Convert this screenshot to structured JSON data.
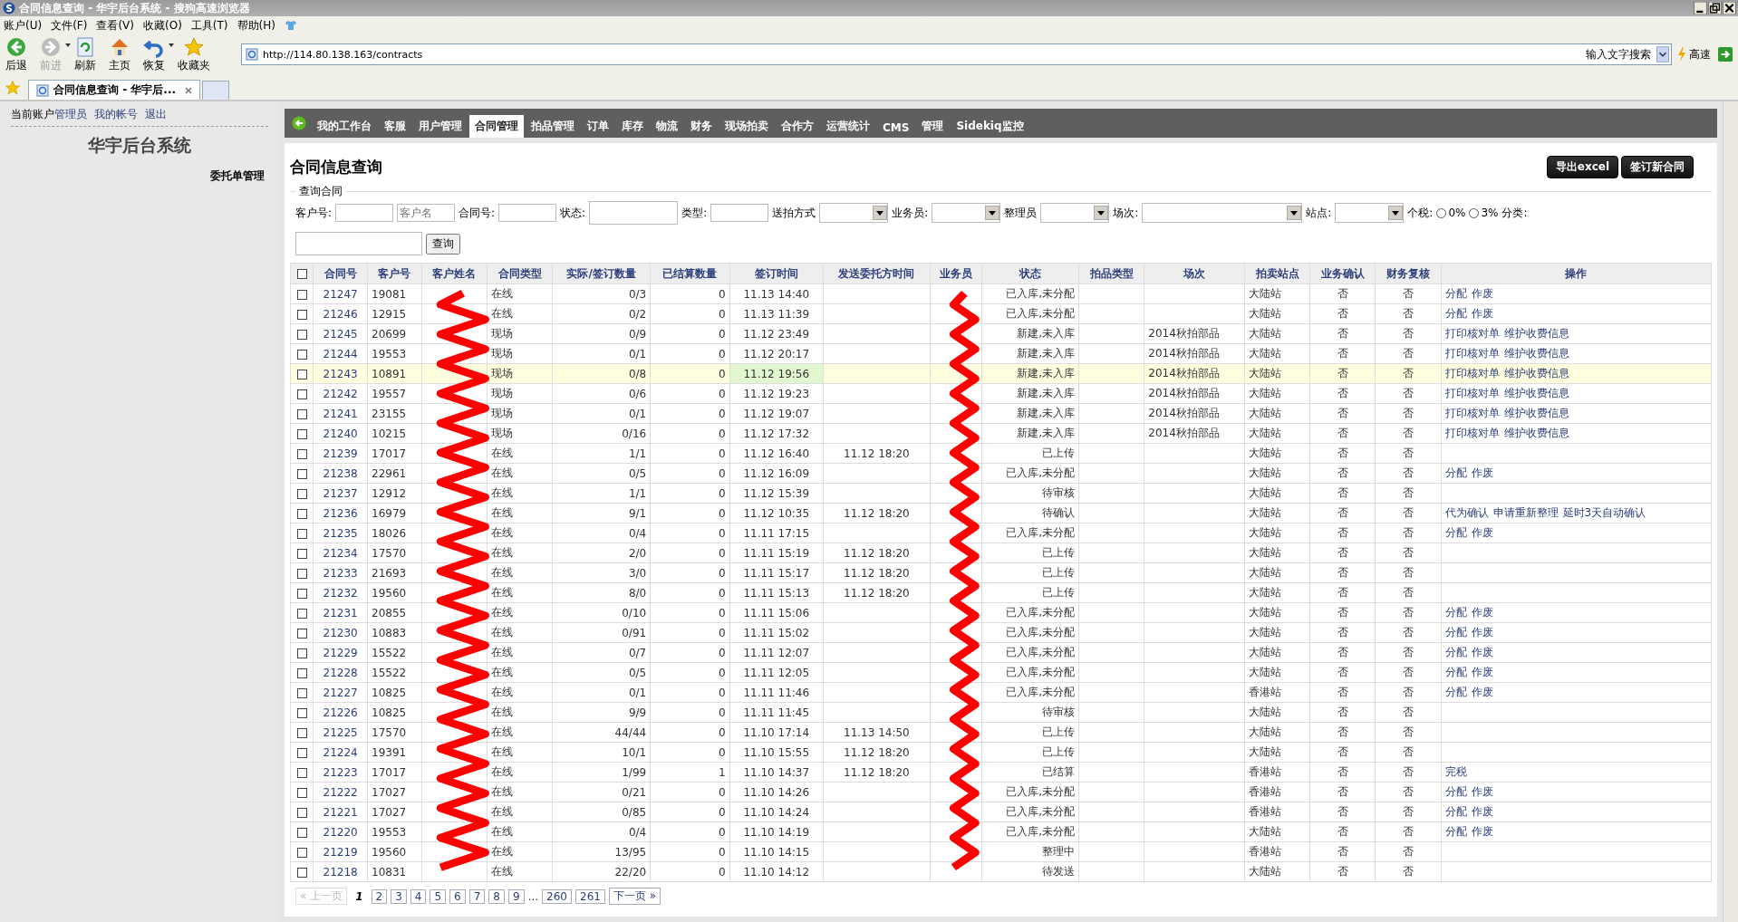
{
  "window": {
    "title": "合同信息查询 - 华宇后台系统 - 搜狗高速浏览器"
  },
  "menu": [
    "账户(U)",
    "文件(F)",
    "查看(V)",
    "收藏(O)",
    "工具(T)",
    "帮助(H)"
  ],
  "toolbar": [
    {
      "label": "后退",
      "kind": "back",
      "disabled": false
    },
    {
      "label": "前进",
      "kind": "forward",
      "disabled": true
    },
    {
      "label": "刷新",
      "kind": "refresh",
      "disabled": false
    },
    {
      "label": "主页",
      "kind": "home",
      "disabled": false
    },
    {
      "label": "恢复",
      "kind": "undo",
      "disabled": false
    },
    {
      "label": "收藏夹",
      "kind": "star",
      "disabled": false
    }
  ],
  "address": "http://114.80.138.163/contracts",
  "search": {
    "placeholder": "输入文字搜索",
    "mode": "高速"
  },
  "tabs": [
    {
      "label": "合同信息查询 - 华宇后...",
      "selected": true
    }
  ],
  "sidebar": {
    "account_label": "当前账户",
    "links": [
      "管理员",
      "我的帐号",
      "退出"
    ],
    "title": "华宇后台系统",
    "section": "委托单管理"
  },
  "nav": [
    {
      "label": "我的工作台",
      "selected": false
    },
    {
      "label": "客服",
      "selected": false
    },
    {
      "label": "用户管理",
      "selected": false
    },
    {
      "label": "合同管理",
      "selected": true
    },
    {
      "label": "拍品管理",
      "selected": false
    },
    {
      "label": "订单",
      "selected": false
    },
    {
      "label": "库存",
      "selected": false
    },
    {
      "label": "物流",
      "selected": false
    },
    {
      "label": "财务",
      "selected": false
    },
    {
      "label": "现场拍卖",
      "selected": false
    },
    {
      "label": "合作方",
      "selected": false
    },
    {
      "label": "运营统计",
      "selected": false
    },
    {
      "label": "CMS",
      "selected": false
    },
    {
      "label": "管理",
      "selected": false
    },
    {
      "label": "Sidekiq监控",
      "selected": false
    }
  ],
  "page_title": "合同信息查询",
  "actions": [
    "导出excel",
    "签订新合同"
  ],
  "filter": {
    "legend": "查询合同",
    "fields": [
      {
        "kind": "text",
        "label": "客户号:"
      },
      {
        "kind": "text",
        "placeholder": "客户名"
      },
      {
        "kind": "text",
        "label": "合同号:"
      },
      {
        "kind": "wide",
        "label": "状态:"
      },
      {
        "kind": "text",
        "label": "类型:"
      },
      {
        "kind": "select",
        "label": "送拍方式"
      },
      {
        "kind": "select",
        "label": "业务员:"
      },
      {
        "kind": "select",
        "label": "整理员"
      },
      {
        "kind": "longselect",
        "label": "场次:"
      },
      {
        "kind": "select",
        "label": "站点:"
      },
      {
        "kind": "radio",
        "label": "个税:",
        "options": [
          {
            "label": "0%",
            "selected": false
          },
          {
            "label": "3%",
            "selected": false
          }
        ]
      },
      {
        "kind": "label",
        "label": "分类:"
      },
      {
        "kind": "wide-newline"
      }
    ],
    "submit": "查询"
  },
  "table": {
    "select_all_checked": false,
    "columns": [
      "合同号",
      "客户号",
      "客户姓名",
      "合同类型",
      "实际/签订数量",
      "已结算数量",
      "签订时间",
      "发送委托方时间",
      "业务员",
      "状态",
      "拍品类型",
      "场次",
      "拍卖站点",
      "业务确认",
      "财务复核",
      "操作"
    ],
    "rows": [
      {
        "id": "21247",
        "customer": "19081",
        "type": "在线",
        "qty": "0/3",
        "settled": "0",
        "signed": "11.13 14:40",
        "status": "已入库,未分配",
        "site": "大陆站",
        "biz": "否",
        "fin": "否",
        "ops": [
          "分配",
          "作废"
        ],
        "checked": false,
        "highlighted": false
      },
      {
        "id": "21246",
        "customer": "12915",
        "type": "在线",
        "qty": "0/2",
        "settled": "0",
        "signed": "11.13 11:39",
        "status": "已入库,未分配",
        "site": "大陆站",
        "biz": "否",
        "fin": "否",
        "ops": [
          "分配",
          "作废"
        ],
        "checked": false,
        "highlighted": false
      },
      {
        "id": "21245",
        "customer": "20699",
        "type": "现场",
        "qty": "0/9",
        "settled": "0",
        "signed": "11.12 23:49",
        "status": "新建,未入库",
        "session": "2014秋拍部品",
        "site": "大陆站",
        "biz": "否",
        "fin": "否",
        "ops": [
          "打印核对单",
          "维护收费信息"
        ],
        "checked": false,
        "highlighted": false
      },
      {
        "id": "21244",
        "customer": "19553",
        "type": "现场",
        "qty": "0/1",
        "settled": "0",
        "signed": "11.12 20:17",
        "status": "新建,未入库",
        "session": "2014秋拍部品",
        "site": "大陆站",
        "biz": "否",
        "fin": "否",
        "ops": [
          "打印核对单",
          "维护收费信息"
        ],
        "checked": false,
        "highlighted": false
      },
      {
        "id": "21243",
        "customer": "10891",
        "type": "现场",
        "qty": "0/8",
        "settled": "0",
        "signed": "11.12 19:56",
        "status": "新建,未入库",
        "session": "2014秋拍部品",
        "site": "大陆站",
        "biz": "否",
        "fin": "否",
        "ops": [
          "打印核对单",
          "维护收费信息"
        ],
        "checked": false,
        "highlighted": true
      },
      {
        "id": "21242",
        "customer": "19557",
        "type": "现场",
        "qty": "0/6",
        "settled": "0",
        "signed": "11.12 19:23",
        "status": "新建,未入库",
        "session": "2014秋拍部品",
        "site": "大陆站",
        "biz": "否",
        "fin": "否",
        "ops": [
          "打印核对单",
          "维护收费信息"
        ],
        "checked": false,
        "highlighted": false
      },
      {
        "id": "21241",
        "customer": "23155",
        "type": "现场",
        "qty": "0/1",
        "settled": "0",
        "signed": "11.12 19:07",
        "status": "新建,未入库",
        "session": "2014秋拍部品",
        "site": "大陆站",
        "biz": "否",
        "fin": "否",
        "ops": [
          "打印核对单",
          "维护收费信息"
        ],
        "checked": false,
        "highlighted": false
      },
      {
        "id": "21240",
        "customer": "10215",
        "type": "现场",
        "qty": "0/16",
        "settled": "0",
        "signed": "11.12 17:32",
        "status": "新建,未入库",
        "session": "2014秋拍部品",
        "site": "大陆站",
        "biz": "否",
        "fin": "否",
        "ops": [
          "打印核对单",
          "维护收费信息"
        ],
        "checked": false,
        "highlighted": false
      },
      {
        "id": "21239",
        "customer": "17017",
        "type": "在线",
        "qty": "1/1",
        "settled": "0",
        "signed": "11.12 16:40",
        "sent": "11.12 18:20",
        "status": "已上传",
        "site": "大陆站",
        "biz": "否",
        "fin": "否",
        "checked": false,
        "highlighted": false
      },
      {
        "id": "21238",
        "customer": "22961",
        "type": "在线",
        "qty": "0/5",
        "settled": "0",
        "signed": "11.12 16:09",
        "status": "已入库,未分配",
        "site": "大陆站",
        "biz": "否",
        "fin": "否",
        "ops": [
          "分配",
          "作废"
        ],
        "checked": false,
        "highlighted": false
      },
      {
        "id": "21237",
        "customer": "12912",
        "type": "在线",
        "qty": "1/1",
        "settled": "0",
        "signed": "11.12 15:39",
        "status": "待审核",
        "site": "大陆站",
        "biz": "否",
        "fin": "否",
        "checked": false,
        "highlighted": false
      },
      {
        "id": "21236",
        "customer": "16979",
        "type": "在线",
        "qty": "9/1",
        "settled": "0",
        "signed": "11.12 10:35",
        "sent": "11.12 18:20",
        "status": "待确认",
        "site": "大陆站",
        "biz": "否",
        "fin": "否",
        "ops": [
          "代为确认",
          "申请重新整理",
          "延时3天自动确认"
        ],
        "checked": false,
        "highlighted": false
      },
      {
        "id": "21235",
        "customer": "18026",
        "type": "在线",
        "qty": "0/4",
        "settled": "0",
        "signed": "11.11 17:15",
        "status": "已入库,未分配",
        "site": "大陆站",
        "biz": "否",
        "fin": "否",
        "ops": [
          "分配",
          "作废"
        ],
        "checked": false,
        "highlighted": false
      },
      {
        "id": "21234",
        "customer": "17570",
        "type": "在线",
        "qty": "2/0",
        "settled": "0",
        "signed": "11.11 15:19",
        "sent": "11.12 18:20",
        "status": "已上传",
        "site": "大陆站",
        "biz": "否",
        "fin": "否",
        "checked": false,
        "highlighted": false
      },
      {
        "id": "21233",
        "customer": "21693",
        "type": "在线",
        "qty": "3/0",
        "settled": "0",
        "signed": "11.11 15:17",
        "sent": "11.12 18:20",
        "status": "已上传",
        "site": "大陆站",
        "biz": "否",
        "fin": "否",
        "checked": false,
        "highlighted": false
      },
      {
        "id": "21232",
        "customer": "19560",
        "type": "在线",
        "qty": "8/0",
        "settled": "0",
        "signed": "11.11 15:13",
        "sent": "11.12 18:20",
        "status": "已上传",
        "site": "大陆站",
        "biz": "否",
        "fin": "否",
        "checked": false,
        "highlighted": false
      },
      {
        "id": "21231",
        "customer": "20855",
        "type": "在线",
        "qty": "0/10",
        "settled": "0",
        "signed": "11.11 15:06",
        "status": "已入库,未分配",
        "site": "大陆站",
        "biz": "否",
        "fin": "否",
        "ops": [
          "分配",
          "作废"
        ],
        "checked": false,
        "highlighted": false
      },
      {
        "id": "21230",
        "customer": "10883",
        "type": "在线",
        "qty": "0/91",
        "settled": "0",
        "signed": "11.11 15:02",
        "status": "已入库,未分配",
        "site": "大陆站",
        "biz": "否",
        "fin": "否",
        "ops": [
          "分配",
          "作废"
        ],
        "checked": false,
        "highlighted": false
      },
      {
        "id": "21229",
        "customer": "15522",
        "type": "在线",
        "qty": "0/7",
        "settled": "0",
        "signed": "11.11 12:07",
        "status": "已入库,未分配",
        "site": "大陆站",
        "biz": "否",
        "fin": "否",
        "ops": [
          "分配",
          "作废"
        ],
        "checked": false,
        "highlighted": false
      },
      {
        "id": "21228",
        "customer": "15522",
        "type": "在线",
        "qty": "0/5",
        "settled": "0",
        "signed": "11.11 12:05",
        "status": "已入库,未分配",
        "site": "大陆站",
        "biz": "否",
        "fin": "否",
        "ops": [
          "分配",
          "作废"
        ],
        "checked": false,
        "highlighted": false
      },
      {
        "id": "21227",
        "customer": "10825",
        "type": "在线",
        "qty": "0/1",
        "settled": "0",
        "signed": "11.11 11:46",
        "status": "已入库,未分配",
        "site": "香港站",
        "biz": "否",
        "fin": "否",
        "ops": [
          "分配",
          "作废"
        ],
        "checked": false,
        "highlighted": false
      },
      {
        "id": "21226",
        "customer": "10825",
        "type": "在线",
        "qty": "9/9",
        "settled": "0",
        "signed": "11.11 11:45",
        "status": "待审核",
        "site": "大陆站",
        "biz": "否",
        "fin": "否",
        "checked": false,
        "highlighted": false
      },
      {
        "id": "21225",
        "customer": "17570",
        "type": "在线",
        "qty": "44/44",
        "settled": "0",
        "signed": "11.10 17:14",
        "sent": "11.13 14:50",
        "status": "已上传",
        "site": "大陆站",
        "biz": "否",
        "fin": "否",
        "checked": false,
        "highlighted": false
      },
      {
        "id": "21224",
        "customer": "19391",
        "type": "在线",
        "qty": "10/1",
        "settled": "0",
        "signed": "11.10 15:55",
        "sent": "11.12 18:20",
        "status": "已上传",
        "site": "大陆站",
        "biz": "否",
        "fin": "否",
        "checked": false,
        "highlighted": false
      },
      {
        "id": "21223",
        "customer": "17017",
        "type": "在线",
        "qty": "1/99",
        "settled": "1",
        "signed": "11.10 14:37",
        "sent": "11.12 18:20",
        "status": "已结算",
        "site": "香港站",
        "biz": "否",
        "fin": "否",
        "ops": [
          "完税"
        ],
        "checked": false,
        "highlighted": false
      },
      {
        "id": "21222",
        "customer": "17027",
        "type": "在线",
        "qty": "0/21",
        "settled": "0",
        "signed": "11.10 14:26",
        "status": "已入库,未分配",
        "site": "香港站",
        "biz": "否",
        "fin": "否",
        "ops": [
          "分配",
          "作废"
        ],
        "checked": false,
        "highlighted": false
      },
      {
        "id": "21221",
        "customer": "17027",
        "type": "在线",
        "qty": "0/85",
        "settled": "0",
        "signed": "11.10 14:24",
        "status": "已入库,未分配",
        "site": "香港站",
        "biz": "否",
        "fin": "否",
        "ops": [
          "分配",
          "作废"
        ],
        "checked": false,
        "highlighted": false
      },
      {
        "id": "21220",
        "customer": "19553",
        "type": "在线",
        "qty": "0/4",
        "settled": "0",
        "signed": "11.10 14:19",
        "status": "已入库,未分配",
        "site": "大陆站",
        "biz": "否",
        "fin": "否",
        "ops": [
          "分配",
          "作废"
        ],
        "checked": false,
        "highlighted": false
      },
      {
        "id": "21219",
        "customer": "19560",
        "type": "在线",
        "qty": "13/95",
        "settled": "0",
        "signed": "11.10 14:15",
        "status": "整理中",
        "site": "香港站",
        "biz": "否",
        "fin": "否",
        "checked": false,
        "highlighted": false
      },
      {
        "id": "21218",
        "customer": "10831",
        "type": "在线",
        "qty": "22/20",
        "settled": "0",
        "signed": "11.10 14:12",
        "status": "待发送",
        "site": "大陆站",
        "biz": "否",
        "fin": "否",
        "checked": false,
        "highlighted": false
      }
    ]
  },
  "pagination": {
    "prev": {
      "label": "« 上一页",
      "disabled": true
    },
    "pages": [
      {
        "label": "1",
        "selected": true
      },
      {
        "label": "2",
        "selected": false
      },
      {
        "label": "3",
        "selected": false
      },
      {
        "label": "4",
        "selected": false
      },
      {
        "label": "5",
        "selected": false
      },
      {
        "label": "6",
        "selected": false
      },
      {
        "label": "7",
        "selected": false
      },
      {
        "label": "8",
        "selected": false
      },
      {
        "label": "9",
        "selected": false
      },
      {
        "label": "...",
        "kind": "gap"
      },
      {
        "label": "260",
        "selected": false
      },
      {
        "label": "261",
        "selected": false
      }
    ],
    "next": {
      "label": "下一页 »",
      "disabled": false
    }
  }
}
